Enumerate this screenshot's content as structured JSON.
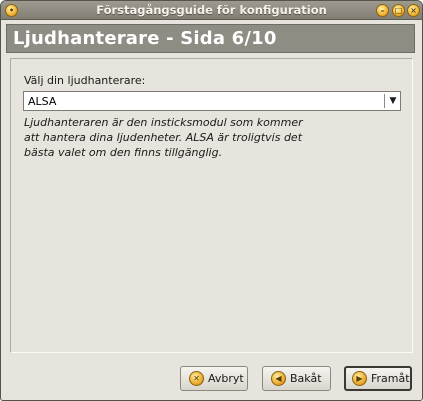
{
  "window": {
    "title": "Förstagångsguide för konfiguration",
    "controls": {
      "menu_icon": "window-menu-icon",
      "minimize_icon": "minimize-icon",
      "maximize_icon": "maximize-icon",
      "close_icon": "close-icon"
    }
  },
  "header": {
    "title": "Ljudhanterare - Sida 6/10"
  },
  "sound_manager": {
    "label": "Välj din ljudhanterare:",
    "selected": "ALSA",
    "description_lines": [
      "Ljudhanteraren är den insticksmodul som kommer",
      "att hantera dina ljudenheter. ALSA är troligtvis det",
      "bästa valet om den finns tillgänglig."
    ]
  },
  "buttons": {
    "cancel": "Avbryt",
    "back": "Bakåt",
    "next": "Framåt"
  },
  "colors": {
    "window_bg": "#e6e4dc",
    "titlebar": "#8f8c84",
    "header_bg": "#8f8c84",
    "accent_icon": "#e6a21f"
  }
}
